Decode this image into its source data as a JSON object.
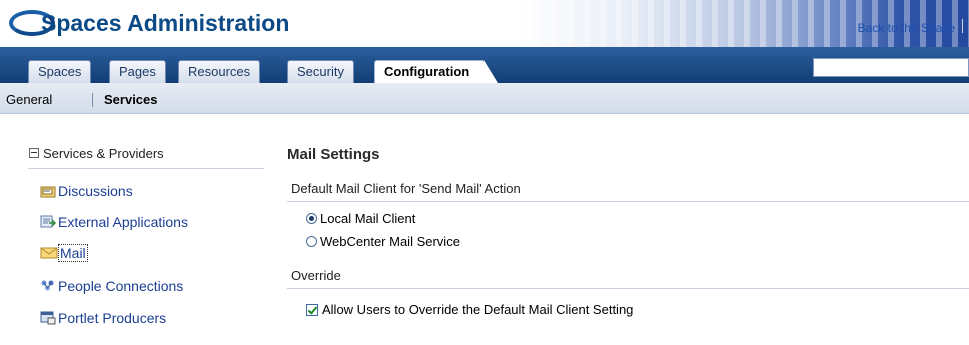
{
  "header": {
    "app_title": "Spaces Administration",
    "back_link": "Back to the Space"
  },
  "tabs": [
    {
      "label": "Spaces",
      "active": false
    },
    {
      "label": "Pages",
      "active": false
    },
    {
      "label": "Resources",
      "active": false
    },
    {
      "label": "Security",
      "active": false
    },
    {
      "label": "Configuration",
      "active": true
    }
  ],
  "search": {
    "value": ""
  },
  "subnav": [
    {
      "label": "General",
      "active": false
    },
    {
      "label": "Services",
      "active": true
    }
  ],
  "left_panel": {
    "heading": "Services & Providers",
    "items": [
      {
        "label": "Discussions",
        "icon": "discussions-icon",
        "selected": false
      },
      {
        "label": "External Applications",
        "icon": "external-apps-icon",
        "selected": false
      },
      {
        "label": "Mail",
        "icon": "mail-icon",
        "selected": true
      },
      {
        "label": "People Connections",
        "icon": "people-icon",
        "selected": false
      },
      {
        "label": "Portlet Producers",
        "icon": "portlet-icon",
        "selected": false
      }
    ]
  },
  "main": {
    "title": "Mail Settings",
    "client_section": {
      "heading": "Default Mail Client for 'Send Mail' Action",
      "options": [
        {
          "label": "Local Mail Client",
          "selected": true
        },
        {
          "label": "WebCenter Mail Service",
          "selected": false
        }
      ]
    },
    "override_section": {
      "heading": "Override",
      "checkbox_label": "Allow Users to Override the Default Mail Client Setting",
      "checked": true
    }
  },
  "colors": {
    "brand_blue": "#0b4a86",
    "tabbar": "#1c4b86",
    "link": "#1c3f94"
  }
}
